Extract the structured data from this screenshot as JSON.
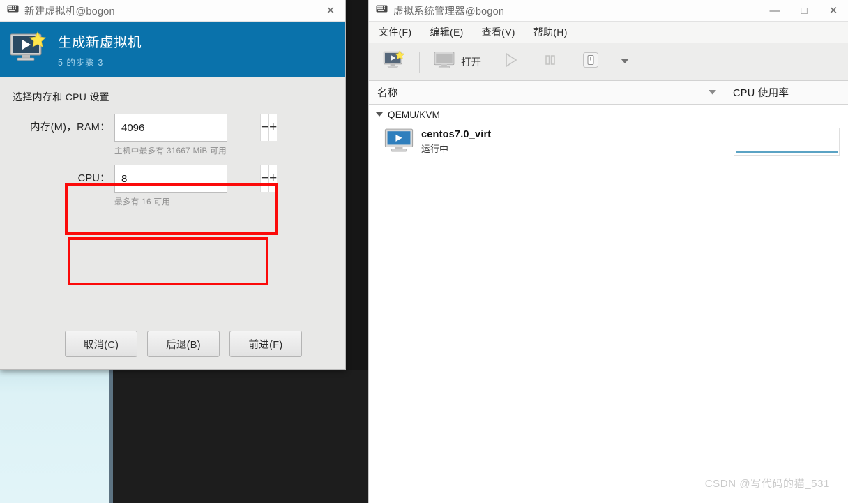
{
  "colors": {
    "wizard_header_blue": "#0a72ab",
    "annotation_red": "#fb0a0a",
    "sparkline_blue": "#5ba3c4",
    "backdrop_cyan": "#ddf2f6",
    "backdrop_dark": "#1d1d1d"
  },
  "new_vm_dialog": {
    "titlebar": {
      "icon": "window-icon",
      "title": "新建虚拟机@bogon",
      "close_label": "✕"
    },
    "header": {
      "icon": "new-vm-star-icon",
      "title": "生成新虚拟机",
      "step": "5 的步骤 3"
    },
    "section_heading": "选择内存和 CPU 设置",
    "fields": [
      {
        "key": "ram",
        "label": "内存(M)，RAM：",
        "value": "4096",
        "minus_label": "−",
        "plus_label": "+",
        "hint": "主机中最多有 31667 MiB 可用"
      },
      {
        "key": "cpu",
        "label": "CPU：",
        "value": "8",
        "minus_label": "−",
        "plus_label": "+",
        "hint": "最多有 16 可用"
      }
    ],
    "buttons": {
      "cancel": "取消(C)",
      "back": "后退(B)",
      "forward": "前进(F)"
    }
  },
  "virt_manager": {
    "titlebar": {
      "icon": "window-icon",
      "title": "虚拟系统管理器@bogon",
      "minimize_label": "—",
      "maximize_label": "□",
      "close_label": "✕"
    },
    "menus": [
      {
        "label": "文件(F)"
      },
      {
        "label": "编辑(E)"
      },
      {
        "label": "查看(V)"
      },
      {
        "label": "帮助(H)"
      }
    ],
    "toolbar": [
      {
        "name": "new-vm-button",
        "icon": "new-vm-star-icon",
        "label": "",
        "disabled": false
      },
      {
        "name": "open-button",
        "icon": "monitor-icon",
        "label": "打开",
        "disabled": false
      },
      {
        "name": "run-button",
        "icon": "play-icon",
        "label": "",
        "disabled": true
      },
      {
        "name": "pause-button",
        "icon": "pause-icon",
        "label": "",
        "disabled": true
      },
      {
        "name": "shutdown-button",
        "icon": "shutdown-icon",
        "label": "",
        "disabled": false
      },
      {
        "name": "shutdown-menu-button",
        "icon": "chevron-down-icon",
        "label": "",
        "disabled": false
      }
    ],
    "columns": {
      "name": "名称",
      "cpu_usage": "CPU 使用率",
      "sort_icon": "chevron-down-icon"
    },
    "group": {
      "expander_icon": "triangle-down-icon",
      "label": "QEMU/KVM"
    },
    "vm": {
      "icon": "vm-running-icon",
      "name": "centos7.0_virt",
      "state": "运行中",
      "cpu_sparkline": {
        "type": "line",
        "values": [
          0,
          0,
          0,
          0,
          0,
          0,
          0,
          0,
          0,
          0
        ],
        "ylim": [
          0,
          100
        ]
      }
    }
  },
  "watermark": "CSDN @写代码的猫_531"
}
